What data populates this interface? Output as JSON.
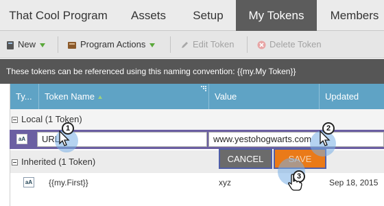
{
  "tabs": [
    {
      "label": "That Cool Program",
      "active": false
    },
    {
      "label": "Assets",
      "active": false
    },
    {
      "label": "Setup",
      "active": false
    },
    {
      "label": "My Tokens",
      "active": true
    },
    {
      "label": "Members",
      "active": false
    }
  ],
  "toolbar": {
    "new_label": "New",
    "program_actions_label": "Program Actions",
    "edit_token_label": "Edit Token",
    "delete_token_label": "Delete Token"
  },
  "info_text": "These tokens can be referenced using this naming convention: {{my.My Token}}",
  "grid": {
    "columns": [
      "Ty...",
      "Token Name",
      "Value",
      "Updated"
    ],
    "local_group": "Local (1 Token)",
    "inherited_group": "Inherited (1 Token)",
    "edit_row": {
      "name_value": "URL",
      "value_value": "www.yestohogwarts.com"
    },
    "cancel_label": "CANCEL",
    "save_label": "SAVE",
    "inherited_row": {
      "name": "{{my.First}}",
      "value": "xyz",
      "updated": "Sep 18, 2015"
    }
  },
  "callouts": [
    "1",
    "2",
    "3"
  ],
  "colors": {
    "accent_purple": "#6b5fa2",
    "header_blue": "#5fa3c5",
    "save_orange": "#ea7a18"
  }
}
